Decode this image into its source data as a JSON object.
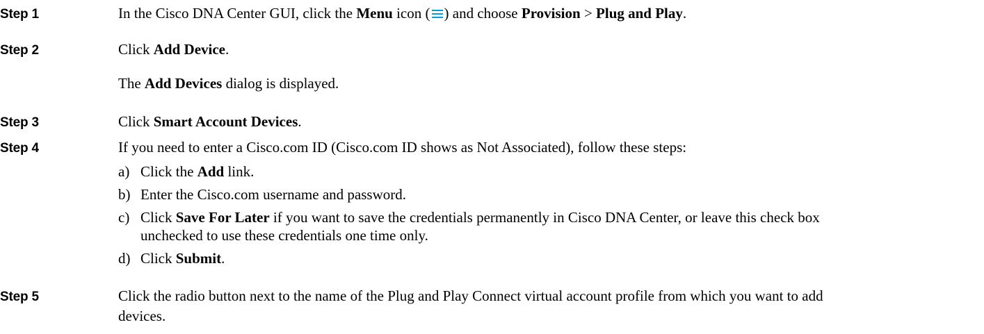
{
  "steps": [
    {
      "label": "Step 1",
      "parts": [
        "In the Cisco DNA Center GUI, click the ",
        "Menu",
        " icon (",
        ") and choose ",
        "Provision",
        " > ",
        "Plug and Play",
        "."
      ]
    },
    {
      "label": "Step 2",
      "parts": [
        "Click ",
        "Add Device",
        "."
      ],
      "note": [
        "The ",
        "Add Devices",
        " dialog is displayed."
      ]
    },
    {
      "label": "Step 3",
      "parts": [
        "Click ",
        "Smart Account Devices",
        "."
      ]
    },
    {
      "label": "Step 4",
      "parts": [
        "If you need to enter a Cisco.com ID (Cisco.com ID shows as Not Associated), follow these steps:"
      ],
      "substeps": [
        {
          "letter": "a)",
          "parts": [
            "Click the ",
            "Add",
            " link."
          ]
        },
        {
          "letter": "b)",
          "parts": [
            "Enter the Cisco.com username and password."
          ]
        },
        {
          "letter": "c)",
          "parts": [
            "Click ",
            "Save For Later",
            " if you want to save the credentials permanently in Cisco DNA Center, or leave this check box"
          ],
          "cont": "unchecked to use these credentials one time only."
        },
        {
          "letter": "d)",
          "parts": [
            "Click ",
            "Submit",
            "."
          ]
        }
      ]
    },
    {
      "label": "Step 5",
      "parts": [
        "Click the radio button next to the name of the Plug and Play Connect virtual account profile from which you want to add"
      ],
      "cont": "devices."
    }
  ],
  "colors": {
    "menu_icon": "#049fd9"
  },
  "icons": {
    "menu": "hamburger-menu-icon"
  }
}
